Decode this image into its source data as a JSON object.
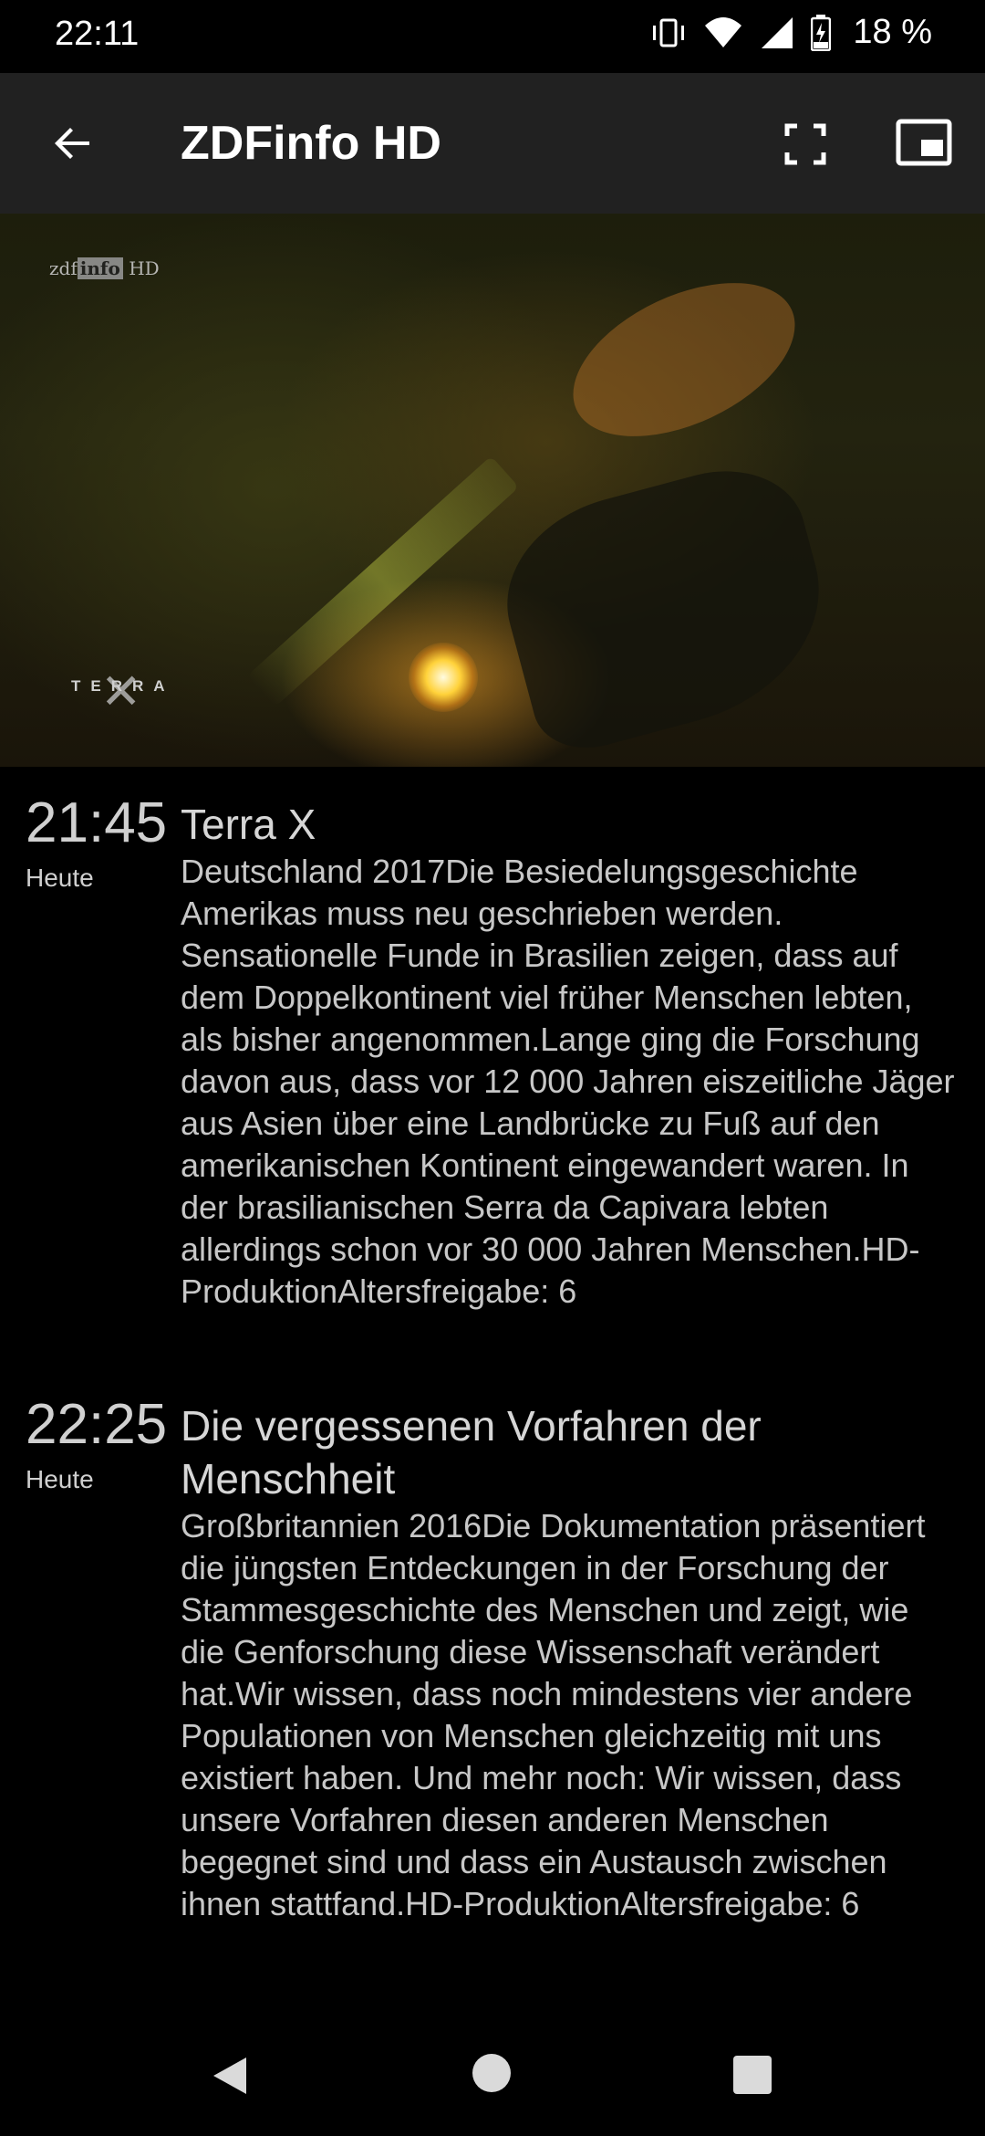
{
  "status_bar": {
    "time": "22:11",
    "battery": "18 %",
    "icons": [
      "vibrate-icon",
      "wifi-icon",
      "signal-icon",
      "battery-charging-icon"
    ]
  },
  "app_bar": {
    "title": "ZDFinfo HD",
    "icons": [
      "back-arrow-icon",
      "fullscreen-icon",
      "picture-in-picture-icon"
    ]
  },
  "video": {
    "channel_logo": "zdf",
    "channel_logo_box": "info",
    "channel_logo_suffix": "HD",
    "show_logo": "TERRA"
  },
  "programs": [
    {
      "time": "21:45",
      "day": "Heute",
      "title": "Terra X",
      "description": "Deutschland 2017⁣Die Besiedelungsgeschichte Amerikas muss neu geschrieben werden. Sensationelle Funde in Brasilien zeigen, dass auf dem Doppelkontinent viel früher Menschen lebten, als bisher angenommen.⁣⁣Lange ging die Forschung davon aus, dass vor 12 000 Jahren eiszeitliche Jäger aus Asien über eine Landbrücke zu Fuß auf den amerikanischen Kontinent eingewandert waren. In der brasilianischen Serra da Capivara lebten allerdings schon vor 30 000 Jahren Menschen.⁣HD-Produktion⁣Altersfreigabe: 6"
    },
    {
      "time": "22:25",
      "day": "Heute",
      "title": "Die vergessenen Vorfahren der Menschheit",
      "description": "Großbritannien 2016⁣Die Dokumentation präsentiert die jüngsten Entdeckungen in der Forschung der Stammesgeschichte des Menschen und zeigt, wie die Genforschung diese Wissenschaft verändert hat.⁣⁣Wir wissen, dass noch mindestens vier andere Populationen von Menschen gleichzeitig mit uns existiert haben. Und mehr noch: Wir wissen, dass unsere Vorfahren diesen anderen Menschen begegnet sind und dass ein Austausch zwischen ihnen stattfand.⁣HD-Produktion⁣Altersfreigabe: 6"
    }
  ],
  "nav_bar": {
    "icons": [
      "nav-back-icon",
      "nav-home-icon",
      "nav-recents-icon"
    ]
  }
}
